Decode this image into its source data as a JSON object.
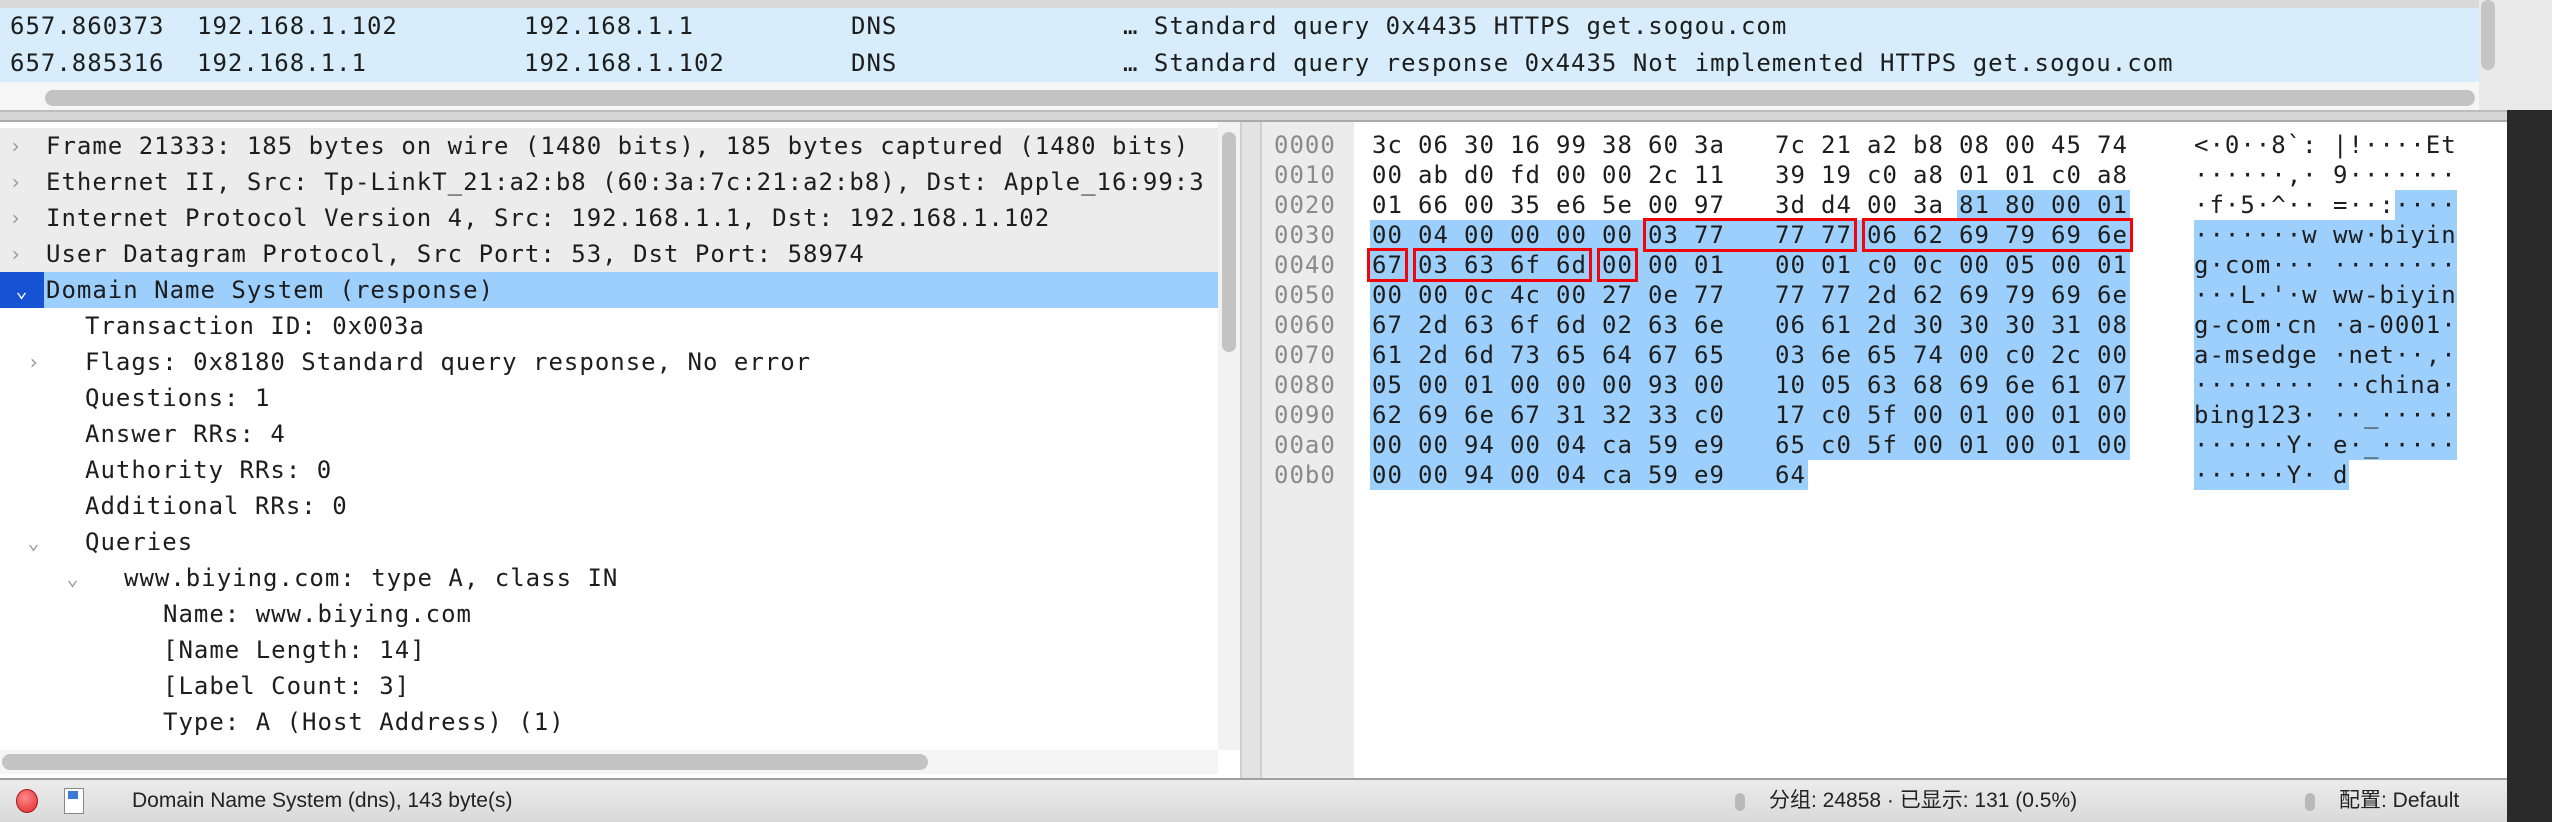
{
  "packet_list": {
    "rows": [
      {
        "time": "657.860373",
        "source": "192.168.1.102",
        "destination": "192.168.1.1",
        "protocol": "DNS",
        "info": "… Standard query 0x4435 HTTPS get.sogou.com"
      },
      {
        "time": "657.885316",
        "source": "192.168.1.1",
        "destination": "192.168.1.102",
        "protocol": "DNS",
        "info": "… Standard query response 0x4435 Not implemented HTTPS get.sogou.com"
      }
    ]
  },
  "details": {
    "rows": [
      {
        "level": 0,
        "chevron": "right",
        "text": "Frame 21333: 185 bytes on wire (1480 bits), 185 bytes captured (1480 bits)"
      },
      {
        "level": 0,
        "chevron": "right",
        "text": "Ethernet II, Src: Tp-LinkT_21:a2:b8 (60:3a:7c:21:a2:b8), Dst: Apple_16:99:3"
      },
      {
        "level": 0,
        "chevron": "right",
        "text": "Internet Protocol Version 4, Src: 192.168.1.1, Dst: 192.168.1.102"
      },
      {
        "level": 0,
        "chevron": "right",
        "text": "User Datagram Protocol, Src Port: 53, Dst Port: 58974"
      },
      {
        "level": 0,
        "chevron": "down",
        "selected": true,
        "text": "Domain Name System (response)"
      },
      {
        "level": 1,
        "text": "Transaction ID: 0x003a"
      },
      {
        "level": 1,
        "chevron": "right",
        "text": "Flags: 0x8180 Standard query response, No error"
      },
      {
        "level": 1,
        "text": "Questions: 1"
      },
      {
        "level": 1,
        "text": "Answer RRs: 4"
      },
      {
        "level": 1,
        "text": "Authority RRs: 0"
      },
      {
        "level": 1,
        "text": "Additional RRs: 0"
      },
      {
        "level": 1,
        "chevron": "down",
        "text": "Queries"
      },
      {
        "level": 2,
        "chevron": "down",
        "text": "www.biying.com: type A, class IN"
      },
      {
        "level": 3,
        "text": "Name: www.biying.com"
      },
      {
        "level": 3,
        "text": "[Name Length: 14]"
      },
      {
        "level": 3,
        "text": "[Label Count: 3]"
      },
      {
        "level": 3,
        "text": "Type: A (Host Address) (1)"
      }
    ]
  },
  "bytes": {
    "highlight_start": 44,
    "red_boxes": [
      {
        "row": 3,
        "from": 6,
        "to": 9
      },
      {
        "row": 3,
        "from": 10,
        "to": 15
      },
      {
        "row": 4,
        "from": 0,
        "to": 0
      },
      {
        "row": 4,
        "from": 1,
        "to": 4
      },
      {
        "row": 4,
        "from": 5,
        "to": 5
      }
    ],
    "rows": [
      {
        "offset": "0000",
        "hex": [
          "3c",
          "06",
          "30",
          "16",
          "99",
          "38",
          "60",
          "3a",
          "7c",
          "21",
          "a2",
          "b8",
          "08",
          "00",
          "45",
          "74"
        ],
        "ascii": "<·0··8`: |!····Et"
      },
      {
        "offset": "0010",
        "hex": [
          "00",
          "ab",
          "d0",
          "fd",
          "00",
          "00",
          "2c",
          "11",
          "39",
          "19",
          "c0",
          "a8",
          "01",
          "01",
          "c0",
          "a8"
        ],
        "ascii": "······,· 9·······"
      },
      {
        "offset": "0020",
        "hex": [
          "01",
          "66",
          "00",
          "35",
          "e6",
          "5e",
          "00",
          "97",
          "3d",
          "d4",
          "00",
          "3a",
          "81",
          "80",
          "00",
          "01"
        ],
        "ascii": "·f·5·^·· =··:····"
      },
      {
        "offset": "0030",
        "hex": [
          "00",
          "04",
          "00",
          "00",
          "00",
          "00",
          "03",
          "77",
          "77",
          "77",
          "06",
          "62",
          "69",
          "79",
          "69",
          "6e"
        ],
        "ascii": "·······w ww·biyin"
      },
      {
        "offset": "0040",
        "hex": [
          "67",
          "03",
          "63",
          "6f",
          "6d",
          "00",
          "00",
          "01",
          "00",
          "01",
          "c0",
          "0c",
          "00",
          "05",
          "00",
          "01"
        ],
        "ascii": "g·com··· ········"
      },
      {
        "offset": "0050",
        "hex": [
          "00",
          "00",
          "0c",
          "4c",
          "00",
          "27",
          "0e",
          "77",
          "77",
          "77",
          "2d",
          "62",
          "69",
          "79",
          "69",
          "6e"
        ],
        "ascii": "···L·'·w ww-biyin"
      },
      {
        "offset": "0060",
        "hex": [
          "67",
          "2d",
          "63",
          "6f",
          "6d",
          "02",
          "63",
          "6e",
          "06",
          "61",
          "2d",
          "30",
          "30",
          "30",
          "31",
          "08"
        ],
        "ascii": "g-com·cn ·a-0001·"
      },
      {
        "offset": "0070",
        "hex": [
          "61",
          "2d",
          "6d",
          "73",
          "65",
          "64",
          "67",
          "65",
          "03",
          "6e",
          "65",
          "74",
          "00",
          "c0",
          "2c",
          "00"
        ],
        "ascii": "a-msedge ·net··,·"
      },
      {
        "offset": "0080",
        "hex": [
          "05",
          "00",
          "01",
          "00",
          "00",
          "00",
          "93",
          "00",
          "10",
          "05",
          "63",
          "68",
          "69",
          "6e",
          "61",
          "07"
        ],
        "ascii": "········ ··china·"
      },
      {
        "offset": "0090",
        "hex": [
          "62",
          "69",
          "6e",
          "67",
          "31",
          "32",
          "33",
          "c0",
          "17",
          "c0",
          "5f",
          "00",
          "01",
          "00",
          "01",
          "00"
        ],
        "ascii": "bing123· ··_·····"
      },
      {
        "offset": "00a0",
        "hex": [
          "00",
          "00",
          "94",
          "00",
          "04",
          "ca",
          "59",
          "e9",
          "65",
          "c0",
          "5f",
          "00",
          "01",
          "00",
          "01",
          "00"
        ],
        "ascii": "······Y· e·_·····"
      },
      {
        "offset": "00b0",
        "hex": [
          "00",
          "00",
          "94",
          "00",
          "04",
          "ca",
          "59",
          "e9",
          "64"
        ],
        "ascii": "······Y· d"
      }
    ]
  },
  "status": {
    "expert_icon": "red-circle",
    "protocol_text": "Domain Name System (dns), 143 byte(s)",
    "packets_text": "分组: 24858 · 已显示: 131 (0.5%)",
    "profile_text": "配置: Default"
  },
  "colors": {
    "selection": "#9dcffd",
    "packet_row": "#d7edfb",
    "red_box": "#f0050a",
    "selected_chevron": "#1552d4"
  }
}
